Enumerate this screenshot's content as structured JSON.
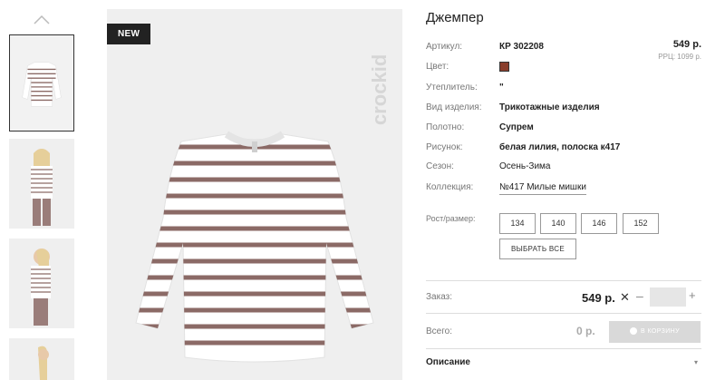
{
  "product": {
    "title": "Джемпер",
    "badge": "NEW",
    "brand_logo": "crockid",
    "price": "549 р.",
    "rrp": "РРЦ: 1099 р."
  },
  "attributes": [
    {
      "label": "Артикул:",
      "value": "КР 302208",
      "style": "bold"
    },
    {
      "label": "Цвет:",
      "value": "",
      "style": "swatch"
    },
    {
      "label": "Утеплитель:",
      "value": "\"",
      "style": "bold"
    },
    {
      "label": "Вид изделия:",
      "value": "Трикотажные изделия",
      "style": "bold"
    },
    {
      "label": "Полотно:",
      "value": "Супрем",
      "style": "bold"
    },
    {
      "label": "Рисунок:",
      "value": "белая лилия, полоска к417",
      "style": "bold"
    },
    {
      "label": "Сезон:",
      "value": "Осень-Зима",
      "style": "plain"
    },
    {
      "label": "Коллекция:",
      "value": "№417 Милые мишки",
      "style": "link"
    }
  ],
  "colors": {
    "swatch": "#8a3e2c",
    "stripe": "#8b6a66",
    "shirt": "#ffffff"
  },
  "sizes": {
    "label": "Рост/размер:",
    "options": [
      "134",
      "140",
      "146",
      "152"
    ],
    "select_all": "ВЫБРАТЬ ВСЕ"
  },
  "order": {
    "label": "Заказ:",
    "price": "549 р.",
    "remove_symbol": "✕",
    "minus": "–",
    "plus": "+",
    "quantity": ""
  },
  "total": {
    "label": "Всего:",
    "value": "0 р.",
    "cart_button": "В КОРЗИНУ"
  },
  "description": {
    "label": "Описание",
    "arrow": "▾"
  },
  "thumbs": {
    "up_icon": "chevron-up-icon"
  }
}
